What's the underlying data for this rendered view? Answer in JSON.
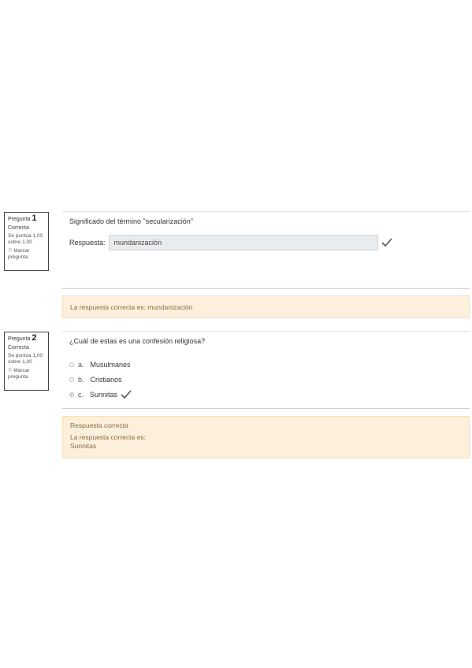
{
  "questions": [
    {
      "number_prefix": "Pregunta",
      "number": "1",
      "state": "Correcta",
      "grade": "Se puntúa 1,00 sobre 1,00",
      "flag_label": "Marcar pregunta",
      "flag_icon": "flag-icon",
      "text": "Significado del término \"secularización\"",
      "answer_label": "Respuesta:",
      "answer_value": "mundanización",
      "correct_icon": "check-icon",
      "feedback": {
        "right_answer": "La respuesta correcta es: mundanización"
      }
    },
    {
      "number_prefix": "Pregunta",
      "number": "2",
      "state": "Correcta",
      "grade": "Se puntúa 1,00 sobre 1,00",
      "flag_label": "Marcar pregunta",
      "flag_icon": "flag-icon",
      "text": "¿Cuál de estas es una confesión religiosa?",
      "options": [
        {
          "letter": "a.",
          "label": "Musulmanes",
          "selected": false
        },
        {
          "letter": "b.",
          "label": "Cristianos",
          "selected": false
        },
        {
          "letter": "c.",
          "label": "Sunnitas",
          "selected": true
        }
      ],
      "correct_icon": "check-icon",
      "feedback": {
        "specific": "Respuesta correcta",
        "right_answer_label": "La respuesta correcta es:",
        "right_answer_value": "Sunnitas"
      }
    }
  ],
  "colors": {
    "feedback_bg": "#fcefdc",
    "feedback_text": "#8a6d3b",
    "input_bg": "#e9ecef",
    "check": "#555555"
  }
}
